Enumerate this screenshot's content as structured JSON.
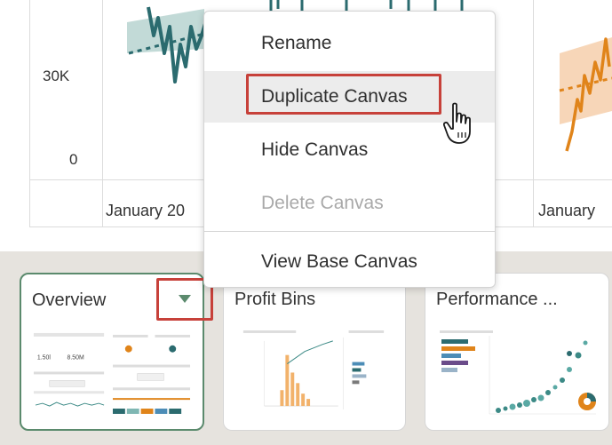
{
  "chart": {
    "y_ticks": [
      "30K",
      "0"
    ],
    "x_labels": [
      "January 20",
      "January"
    ],
    "colors": {
      "teal": "#2b6b6f",
      "teal_band": "#b7d3d0",
      "orange": "#e0841a",
      "orange_band": "#f6d2b0"
    }
  },
  "context_menu": {
    "items": [
      {
        "label": "Rename",
        "state": "normal"
      },
      {
        "label": "Duplicate Canvas",
        "state": "highlighted"
      },
      {
        "label": "Hide Canvas",
        "state": "normal"
      },
      {
        "label": "Delete Canvas",
        "state": "disabled"
      },
      {
        "label": "View Base Canvas",
        "state": "normal"
      }
    ],
    "accent": "#c7413a"
  },
  "canvas_tabs": [
    {
      "title": "Overview",
      "selected": true,
      "dropdown_icon": "caret-down-icon"
    },
    {
      "title": "Profit Bins",
      "selected": false
    },
    {
      "title": "Performance ...",
      "selected": false
    }
  ],
  "thumbnails": {
    "overview": {
      "kpi_1": "1.50l",
      "kpi_2": "8.50M"
    }
  }
}
